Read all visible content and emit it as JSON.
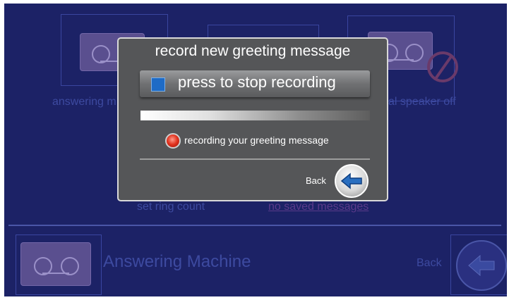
{
  "background": {
    "tiles": [
      {
        "label": "answering m"
      },
      {
        "label": "al speaker off"
      }
    ],
    "set_ring_count": "set ring count",
    "no_saved_messages": "no saved messages",
    "app_title": "Answering Machine",
    "back_label": "Back"
  },
  "modal": {
    "title": "record new greeting message",
    "stop_button_label": "press to stop recording",
    "status_text": "recording your greeting message",
    "back_label": "Back"
  },
  "colors": {
    "screen_bg": "#1c2266",
    "modal_bg": "#555658",
    "stop_indicator": "#1e6bc6",
    "recording_indicator": "#e0301c"
  }
}
